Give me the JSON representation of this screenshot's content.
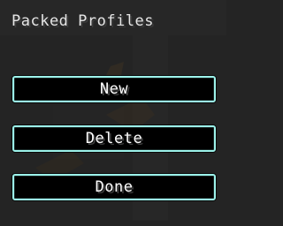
{
  "screen": {
    "title": "Packed Profiles"
  },
  "buttons": {
    "new_label": "New",
    "delete_label": "Delete",
    "done_label": "Done"
  },
  "colors": {
    "background": "#242424",
    "button_border": "#9cf2ea",
    "button_fill": "#000000",
    "text": "#ffffff"
  }
}
